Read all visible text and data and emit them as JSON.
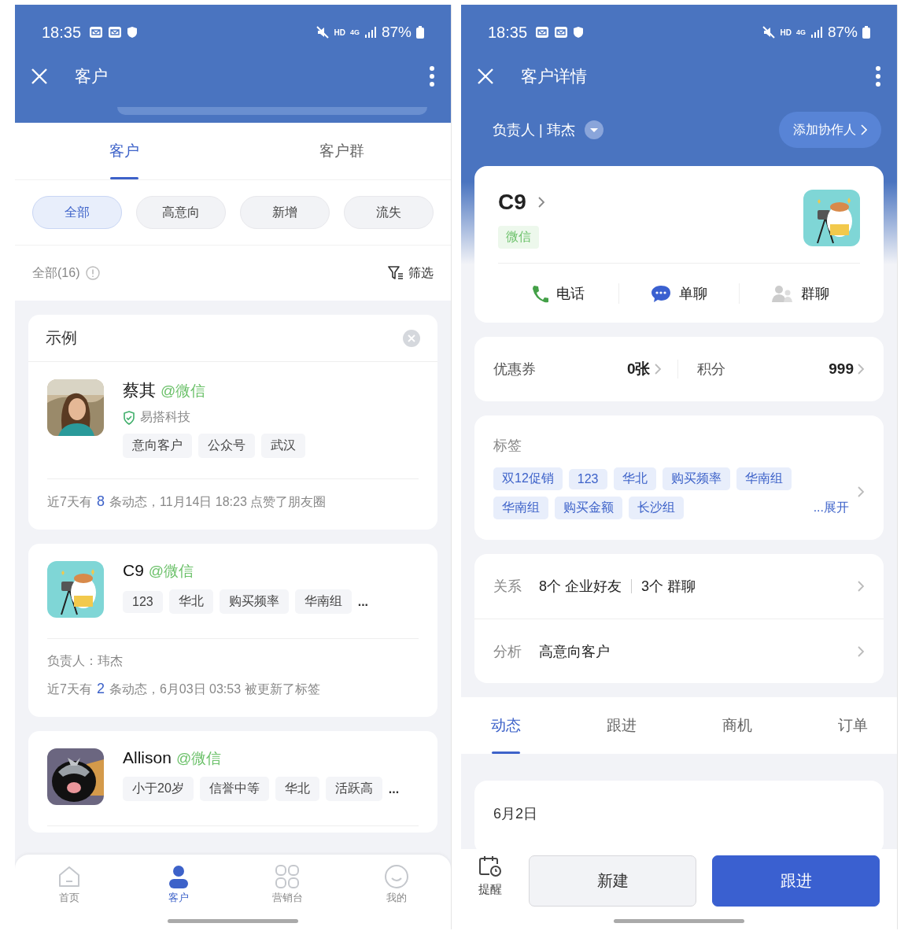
{
  "customer_list": {
    "status_bar": {
      "time": "18:35",
      "hd": "HD",
      "network": "4G",
      "battery": "87%"
    },
    "title": "客户",
    "tabs": [
      {
        "label": "客户",
        "selected": true
      },
      {
        "label": "客户群",
        "selected": false
      }
    ],
    "filters": [
      {
        "label": "全部",
        "selected": true
      },
      {
        "label": "高意向",
        "selected": false
      },
      {
        "label": "新增",
        "selected": false
      },
      {
        "label": "流失",
        "selected": false
      }
    ],
    "count": "全部(16)",
    "filter_button": "筛选",
    "cards": [
      {
        "header": "示例",
        "name": "蔡其",
        "source": "@微信",
        "company": "易搭科技",
        "tags": [
          "意向客户",
          "公众号",
          "武汉"
        ],
        "activity": {
          "prefix": "近7天有",
          "count": "8",
          "suffix": "条动态，11月14日 18:23 点赞了朋友圈"
        }
      },
      {
        "name": "C9",
        "source": "@微信",
        "tags": [
          "123",
          "华北",
          "购买频率",
          "华南组"
        ],
        "more": "...",
        "owner": "负责人：玮杰",
        "activity": {
          "prefix": "近7天有",
          "count": "2",
          "suffix": "条动态，6月03日 03:53  被更新了标签"
        }
      },
      {
        "name": "Allison",
        "source": "@微信",
        "tags": [
          "小于20岁",
          "信誉中等",
          "华北",
          "活跃高"
        ],
        "more": "..."
      }
    ],
    "bottom_nav": [
      {
        "label": "首页",
        "kind": "home",
        "selected": false
      },
      {
        "label": "客户",
        "kind": "person",
        "selected": true
      },
      {
        "label": "营销台",
        "kind": "grid",
        "selected": false
      },
      {
        "label": "我的",
        "kind": "smile",
        "selected": false
      }
    ]
  },
  "customer_detail": {
    "status_bar": {
      "time": "18:35",
      "hd": "HD",
      "network": "4G",
      "battery": "87%"
    },
    "title": "客户详情",
    "owner": "负责人 | 玮杰",
    "add_collaborator": "添加协作人",
    "profile": {
      "name": "C9",
      "source_tag": "微信",
      "actions": [
        {
          "label": "电话",
          "kind": "phone"
        },
        {
          "label": "单聊",
          "kind": "chat"
        },
        {
          "label": "群聊",
          "kind": "group"
        }
      ]
    },
    "stats": [
      {
        "label": "优惠券",
        "value": "0张"
      },
      {
        "label": "积分",
        "value": "999"
      }
    ],
    "tags": {
      "title": "标签",
      "items": [
        "双12促销",
        "123",
        "华北",
        "购买频率",
        "华南组",
        "华南组",
        "购买金额",
        "长沙组"
      ],
      "expand": "...展开"
    },
    "relations": {
      "label": "关系",
      "friends": "8个 企业好友",
      "groups": "3个 群聊"
    },
    "analysis": {
      "label": "分析",
      "value": "高意向客户"
    },
    "tabs": [
      {
        "label": "动态",
        "selected": true
      },
      {
        "label": "跟进",
        "selected": false
      },
      {
        "label": "商机",
        "selected": false
      },
      {
        "label": "订单",
        "selected": false
      }
    ],
    "feed": {
      "date": "6月2日"
    },
    "bottom": {
      "reminder": "提醒",
      "new": "新建",
      "follow": "跟进"
    }
  }
}
